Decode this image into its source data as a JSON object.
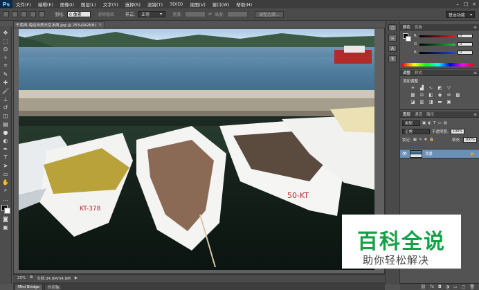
{
  "menubar": {
    "logo": "Ps",
    "items": [
      "文件(F)",
      "编辑(E)",
      "图像(I)",
      "图层(L)",
      "文字(Y)",
      "选择(S)",
      "滤镜(T)",
      "3D(D)",
      "视图(V)",
      "窗口(W)",
      "帮助(H)"
    ]
  },
  "options": {
    "feather_label": "羽化:",
    "feather_value": "0 像素",
    "antialias_label": "消除锯齿",
    "style_label": "样式:",
    "style_value": "正常",
    "width_label": "宽度:",
    "height_label": "高度:",
    "refine_button": "调整边缘...",
    "workspace": "基本功能"
  },
  "document": {
    "tab_title": "千库网-海边自然天空水面.jpg @ 25%(RGB/8)",
    "close": "×"
  },
  "statusbar": {
    "zoom": "25%",
    "doc_info": "文档:34.8M/34.8M"
  },
  "bottom_tabs": [
    "Mini Bridge",
    "时间轴"
  ],
  "panels": {
    "color_tabs": [
      "颜色",
      "色板"
    ],
    "r_label": "R",
    "g_label": "G",
    "b_label": "B",
    "r_value": "0",
    "g_value": "0",
    "b_value": "0",
    "adjust_tabs": [
      "调整",
      "样式"
    ],
    "adjust_add_label": "添加调整",
    "layers_tabs": [
      "图层",
      "通道",
      "路径"
    ],
    "kind_label": "类型",
    "blend_mode": "正常",
    "opacity_label": "不透明度:",
    "opacity_value": "100%",
    "lock_label": "锁定:",
    "fill_label": "填充:",
    "fill_value": "100%",
    "layer_name": "背景"
  },
  "colors": {
    "r_slider": "#e02020",
    "g_slider": "#20c040",
    "b_slider": "#2040e0"
  },
  "watermark": {
    "title": "百科全说",
    "subtitle": "助你轻松解决"
  }
}
